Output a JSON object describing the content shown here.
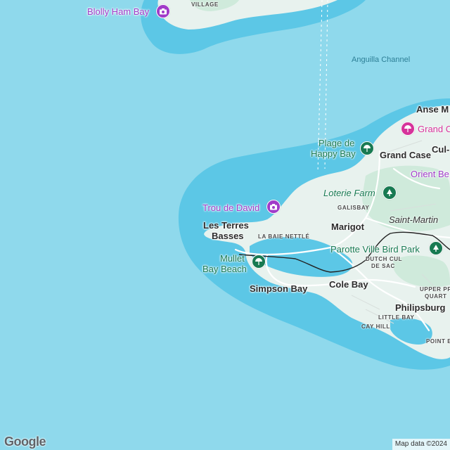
{
  "colors": {
    "ocean": "#8fd9ec",
    "shallow": "#5cc7e6",
    "land": "#e8f2ee",
    "forest": "#cfeadb",
    "road": "#ffffff",
    "border": "#222222",
    "purple_poi": "#a13bc9",
    "pink_poi": "#d6339a",
    "green_poi": "#187a52"
  },
  "labels": {
    "blolly_ham_bay": "Blolly Ham Bay",
    "village": "VILLAGE",
    "anguilla_channel": "Anguilla Channel",
    "anse_m": "Anse M",
    "grand_c": "Grand C",
    "plage_de": "Plage de",
    "happy_bay": "Happy Bay",
    "grand_case": "Grand Case",
    "cul": "Cul-",
    "orient_be": "Orient Be",
    "loterie_farm": "Loterie Farm",
    "galisbay": "GALISBAY",
    "saint_martin": "Saint-Martin",
    "trou_de_david": "Trou de David",
    "les_terres": "Les Terres",
    "basses": "Basses",
    "marigot": "Marigot",
    "la_baie_nettle": "LA BAIE NETTLÉ",
    "parotte_ville": "Parotte Ville Bird Park",
    "dutch_cul": "DUTCH CUL",
    "de_sac": "DE SAC",
    "mullet": "Mullet",
    "bay_beach": "Bay Beach",
    "simpson_bay": "Simpson Bay",
    "cole_bay": "Cole Bay",
    "upper_pr": "UPPER PR",
    "quart": "QUART",
    "philipsburg": "Philipsburg",
    "little_bay": "LITTLE BAY",
    "cay_hill": "CAY HILL",
    "point_blan": "POINT BLAN"
  },
  "icons": {
    "camera": "camera-icon",
    "beach": "beach-umbrella-icon",
    "tree": "tree-icon"
  },
  "logo": "Google",
  "attribution": "Map data ©2024"
}
